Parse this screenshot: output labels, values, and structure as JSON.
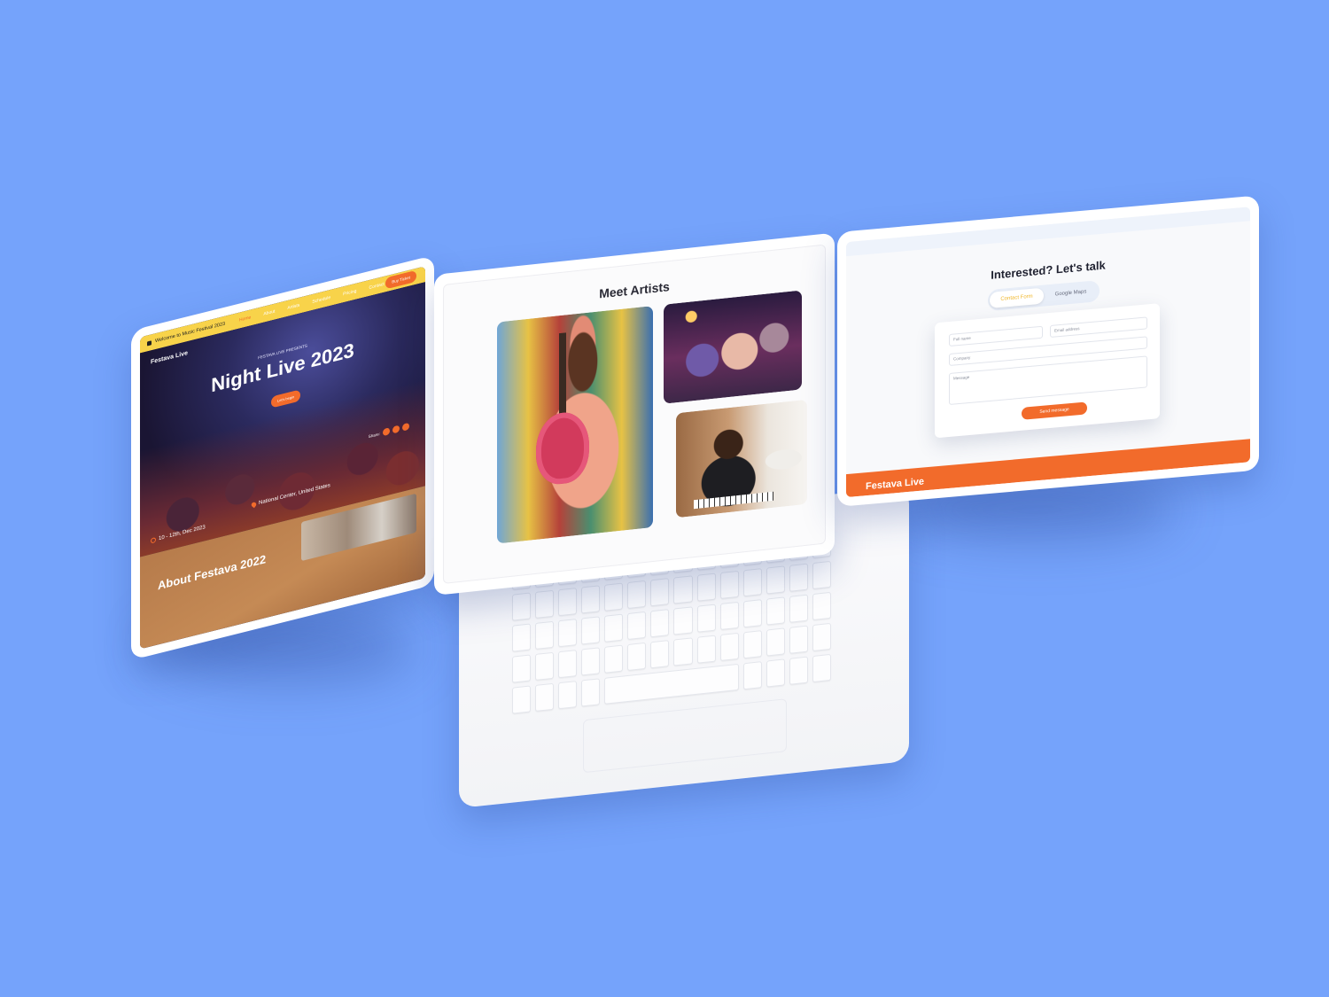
{
  "left_tablet": {
    "announcement": "Welcome to Music Festival 2023",
    "brand": "Festava Live",
    "nav": [
      {
        "label": "Home",
        "active": true
      },
      {
        "label": "About",
        "active": false
      },
      {
        "label": "Artists",
        "active": false
      },
      {
        "label": "Schedule",
        "active": false
      },
      {
        "label": "Pricing",
        "active": false
      },
      {
        "label": "Contact",
        "active": false
      }
    ],
    "ticket_button": "Buy Ticket",
    "presents": "FESTAVA LIVE PRESENTS",
    "hero_title": "Night Live 2023",
    "cta_button": "Let's begin",
    "share_label": "Share:",
    "location": "National Center, United States",
    "date": "10 - 12th, Dec 2023",
    "about_title": "About Festava 2022"
  },
  "laptop": {
    "section_title": "Meet Artists"
  },
  "right_tablet": {
    "title": "Interested? Let's talk",
    "tabs": [
      {
        "label": "Contact Form",
        "active": true
      },
      {
        "label": "Google Maps",
        "active": false
      }
    ],
    "fields": {
      "full_name": "Full name",
      "email": "Email address",
      "company": "Company",
      "message": "Message"
    },
    "send_button": "Send message",
    "footer_brand": "Festava Live"
  },
  "colors": {
    "background": "#75a3fb",
    "accent_orange": "#f26b2b",
    "accent_yellow": "#f8d34a"
  }
}
